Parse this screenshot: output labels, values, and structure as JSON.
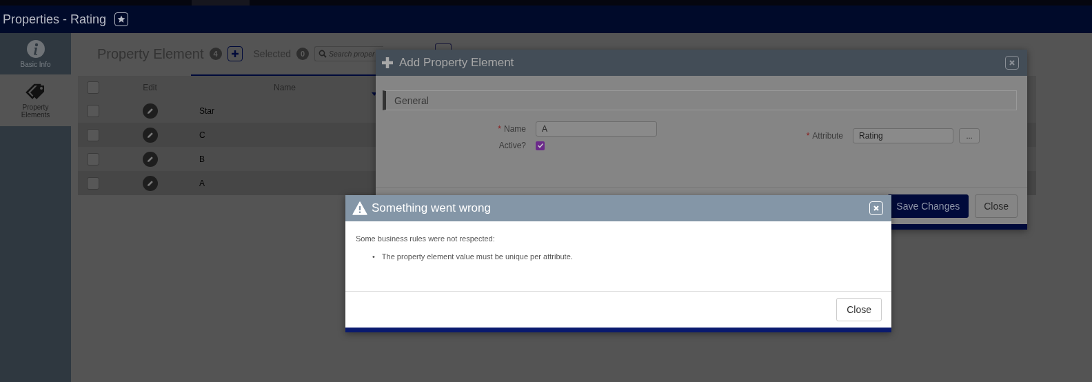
{
  "app_header": {
    "title": "Properties - Rating"
  },
  "sidebar": {
    "items": [
      {
        "label": "Basic Info",
        "selected": false
      },
      {
        "label": "Property Elements",
        "selected": true
      }
    ]
  },
  "toolbar": {
    "title": "Property Element",
    "count": "4",
    "selected_label": "Selected",
    "selected_count": "0",
    "search": {
      "placeholder": "Search proper"
    }
  },
  "table": {
    "select_all_checked": false,
    "columns": [
      "Edit",
      "Name"
    ],
    "rows": [
      {
        "name": "Star",
        "checked": false
      },
      {
        "name": "C",
        "checked": false
      },
      {
        "name": "B",
        "checked": false
      },
      {
        "name": "A",
        "checked": false
      }
    ]
  },
  "add_dialog": {
    "title": "Add Property Element",
    "section": "General",
    "required_mark": "*",
    "fields": [
      {
        "label": "Name",
        "required": true,
        "value": "A"
      },
      {
        "label": "Attribute",
        "required": true,
        "value": "Rating",
        "lookup": "..."
      }
    ],
    "active": {
      "label": "Active?",
      "checked": true
    },
    "buttons": [
      "Save Changes",
      "Close"
    ]
  },
  "error_dialog": {
    "title": "Something went wrong",
    "message": "Some business rules were not respected:",
    "bullet": "•",
    "errors": [
      "The property element value must be unique per attribute."
    ],
    "buttons": [
      "Close"
    ]
  }
}
